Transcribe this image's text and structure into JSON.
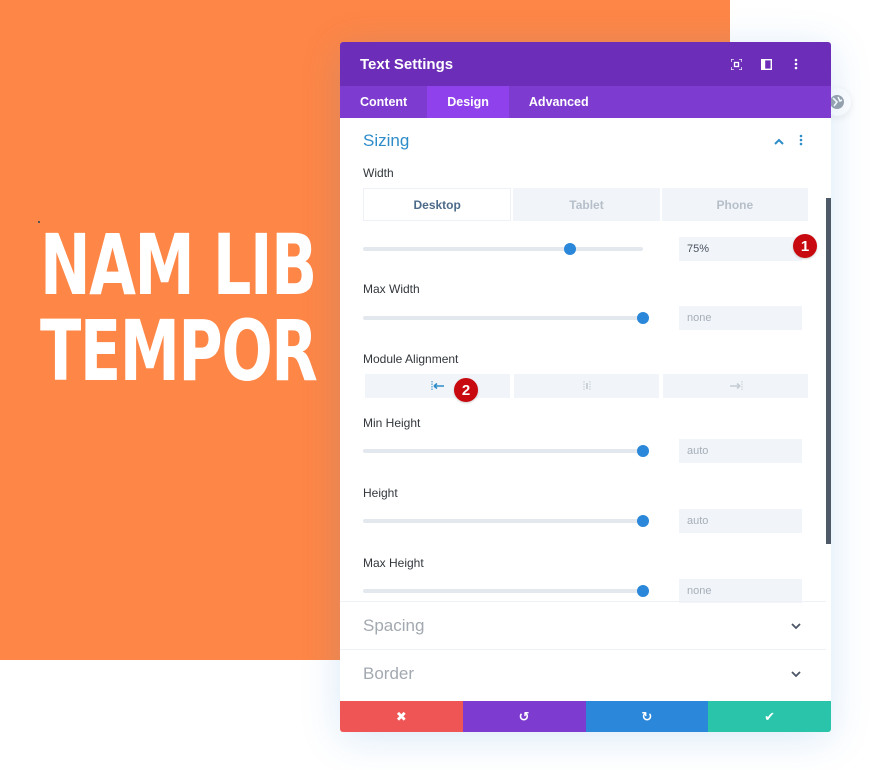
{
  "background": {
    "hero_lines": [
      "NAM LIB",
      "TEMPOR"
    ],
    "colors": {
      "orange": "#fe8646"
    }
  },
  "modal": {
    "title": "Text Settings",
    "header_icons": [
      "fullscreen-icon",
      "split-view-icon",
      "more-options-icon"
    ],
    "tabs": [
      {
        "label": "Content",
        "active": false
      },
      {
        "label": "Design",
        "active": true
      },
      {
        "label": "Advanced",
        "active": false
      }
    ],
    "colors": {
      "header": "#6c2eb9",
      "tabs": "#7e3bd0",
      "active_tab": "#8f42ec",
      "accent": "#2b87da"
    }
  },
  "sizing": {
    "title": "Sizing",
    "expanded": true,
    "width": {
      "label": "Width",
      "device_tabs": [
        "Desktop",
        "Tablet",
        "Phone"
      ],
      "active_device": "Desktop",
      "value": "75%",
      "slider_fraction": 0.74
    },
    "max_width": {
      "label": "Max Width",
      "value": "none",
      "slider_fraction": 1.0
    },
    "module_alignment": {
      "label": "Module Alignment",
      "options": [
        "left",
        "center",
        "right"
      ],
      "selected": "left"
    },
    "min_height": {
      "label": "Min Height",
      "value": "auto",
      "slider_fraction": 1.0
    },
    "height": {
      "label": "Height",
      "value": "auto",
      "slider_fraction": 1.0
    },
    "max_height": {
      "label": "Max Height",
      "value": "none",
      "slider_fraction": 1.0
    }
  },
  "collapsed_sections": [
    {
      "title": "Spacing"
    },
    {
      "title": "Border"
    }
  ],
  "annotations": [
    "1",
    "2"
  ],
  "footer": {
    "buttons": [
      {
        "name": "cancel",
        "icon": "✖",
        "color": "#ef5555"
      },
      {
        "name": "undo",
        "icon": "↺",
        "color": "#7e3bd0"
      },
      {
        "name": "redo",
        "icon": "↻",
        "color": "#2b87da"
      },
      {
        "name": "save",
        "icon": "✔",
        "color": "#29c4a9"
      }
    ]
  }
}
